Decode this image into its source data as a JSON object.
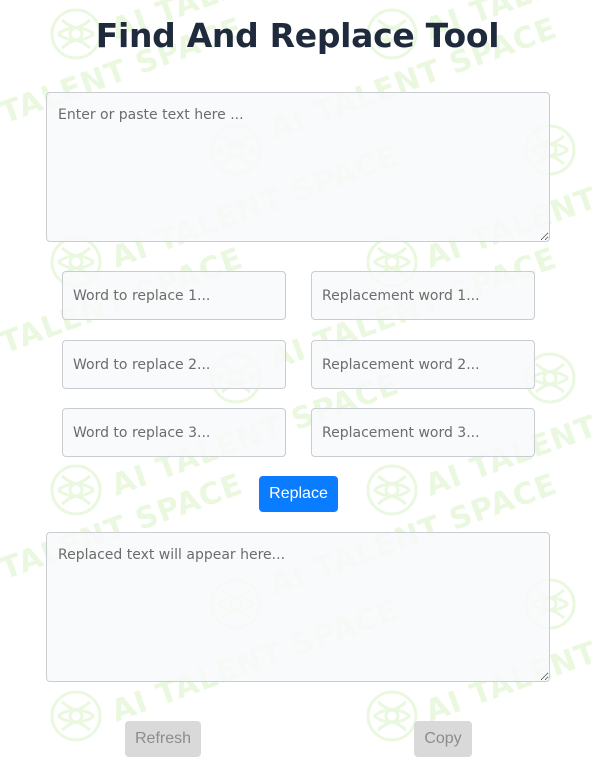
{
  "title": "Find And Replace Tool",
  "watermark": {
    "text": "AI TALENT SPACE",
    "color": "#eaf8df"
  },
  "input_area": {
    "placeholder": "Enter or paste text here ..."
  },
  "find_fields": [
    {
      "placeholder": "Word to replace 1..."
    },
    {
      "placeholder": "Word to replace 2..."
    },
    {
      "placeholder": "Word to replace 3..."
    }
  ],
  "replace_fields": [
    {
      "placeholder": "Replacement word 1..."
    },
    {
      "placeholder": "Replacement word 2..."
    },
    {
      "placeholder": "Replacement word 3..."
    }
  ],
  "replace_button": {
    "label": "Replace",
    "color": "#0a7cff"
  },
  "output_area": {
    "placeholder": "Replaced text will appear here..."
  },
  "refresh_button": {
    "label": "Refresh",
    "color": "#d9d9d9"
  },
  "copy_button": {
    "label": "Copy",
    "color": "#d9d9d9"
  }
}
